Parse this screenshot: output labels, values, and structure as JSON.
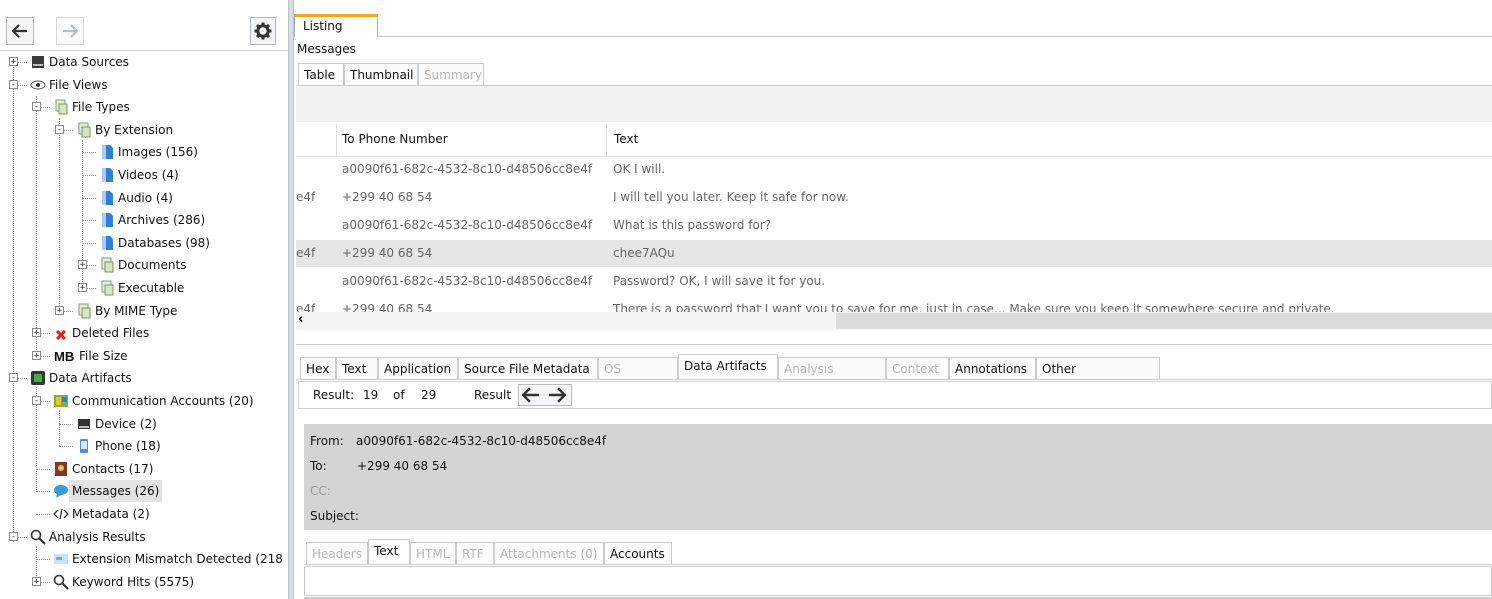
{
  "left": {
    "back_icon": "arrow-left",
    "forward_icon": "arrow-right",
    "settings_icon": "gear",
    "tree": [
      {
        "label": "Data Sources",
        "icon": "drive-icon",
        "exp": "+"
      },
      {
        "label": "File Views",
        "icon": "eye-icon",
        "exp": "-"
      },
      {
        "label": "File Types",
        "icon": "file-types-icon",
        "exp": "-"
      },
      {
        "label": "By Extension",
        "icon": "file-types-icon",
        "exp": "-"
      },
      {
        "label": "Images (156)",
        "icon": "file-blue-icon"
      },
      {
        "label": "Videos (4)",
        "icon": "file-blue-icon"
      },
      {
        "label": "Audio (4)",
        "icon": "file-blue-icon"
      },
      {
        "label": "Archives (286)",
        "icon": "file-blue-icon"
      },
      {
        "label": "Databases (98)",
        "icon": "file-blue-icon"
      },
      {
        "label": "Documents",
        "icon": "file-types-icon",
        "exp": "+"
      },
      {
        "label": "Executable",
        "icon": "file-types-icon",
        "exp": "+"
      },
      {
        "label": "By MIME Type",
        "icon": "file-types-icon",
        "exp": "+"
      },
      {
        "label": "Deleted Files",
        "icon": "deleted-x-icon",
        "exp": "+"
      },
      {
        "label": "File Size",
        "icon": "mb-icon",
        "icon_text": "MB",
        "exp": "+"
      },
      {
        "label": "Data Artifacts",
        "icon": "data-artifacts-icon",
        "exp": "-"
      },
      {
        "label": "Communication Accounts (20)",
        "icon": "comm-accounts-icon",
        "exp": "-"
      },
      {
        "label": "Device (2)",
        "icon": "device-icon"
      },
      {
        "label": "Phone (18)",
        "icon": "phone-icon"
      },
      {
        "label": "Contacts (17)",
        "icon": "contacts-icon"
      },
      {
        "label": "Messages (26)",
        "icon": "messages-icon"
      },
      {
        "label": "Metadata (2)",
        "icon": "code-icon"
      },
      {
        "label": "Analysis Results",
        "icon": "magnifier-icon",
        "exp": "-"
      },
      {
        "label": "Extension Mismatch Detected (218",
        "icon": "mismatch-icon"
      },
      {
        "label": "Keyword Hits (5575)",
        "icon": "magnifier-icon",
        "exp": "+"
      }
    ]
  },
  "listing": {
    "tab": "Listing",
    "heading": "Messages",
    "view_tabs": [
      "Table",
      "Thumbnail",
      "Summary"
    ],
    "columns": [
      "To Phone Number",
      "Text"
    ],
    "rows": [
      {
        "left": "",
        "to": "a0090f61-682c-4532-8c10-d48506cc8e4f",
        "text": "OK I will."
      },
      {
        "left": "e4f",
        "to": "+299 40 68 54",
        "text": "I will tell you later. Keep it safe for now."
      },
      {
        "left": "",
        "to": "a0090f61-682c-4532-8c10-d48506cc8e4f",
        "text": "What is this password for?"
      },
      {
        "left": "e4f",
        "to": "+299 40 68 54",
        "text": "chee7AQu"
      },
      {
        "left": "",
        "to": "a0090f61-682c-4532-8c10-d48506cc8e4f",
        "text": "Password? OK, I will save it for you."
      },
      {
        "left": "e4f",
        "to": "+299 40 68 54",
        "text": "There is a password that I want you to save for me, just in case... Make sure you keep it somewhere secure and private."
      }
    ],
    "selected_row": 3
  },
  "content": {
    "tabs": [
      "Hex",
      "Text",
      "Application",
      "Source File Metadata",
      "OS Account",
      "Data Artifacts",
      "Analysis Results",
      "Context",
      "Annotations",
      "Other Occurrences"
    ],
    "result_label": "Result:",
    "result_current": "19",
    "result_of": "of",
    "result_total": "29",
    "result_nav_label": "Result",
    "from_label": "From:",
    "from_value": "a0090f61-682c-4532-8c10-d48506cc8e4f",
    "to_label": "To:",
    "to_value": "+299 40 68 54",
    "cc_label": "CC:",
    "subject_label": "Subject:",
    "msg_tabs": [
      "Headers",
      "Text",
      "HTML",
      "RTF",
      "Attachments (0)",
      "Accounts"
    ]
  }
}
